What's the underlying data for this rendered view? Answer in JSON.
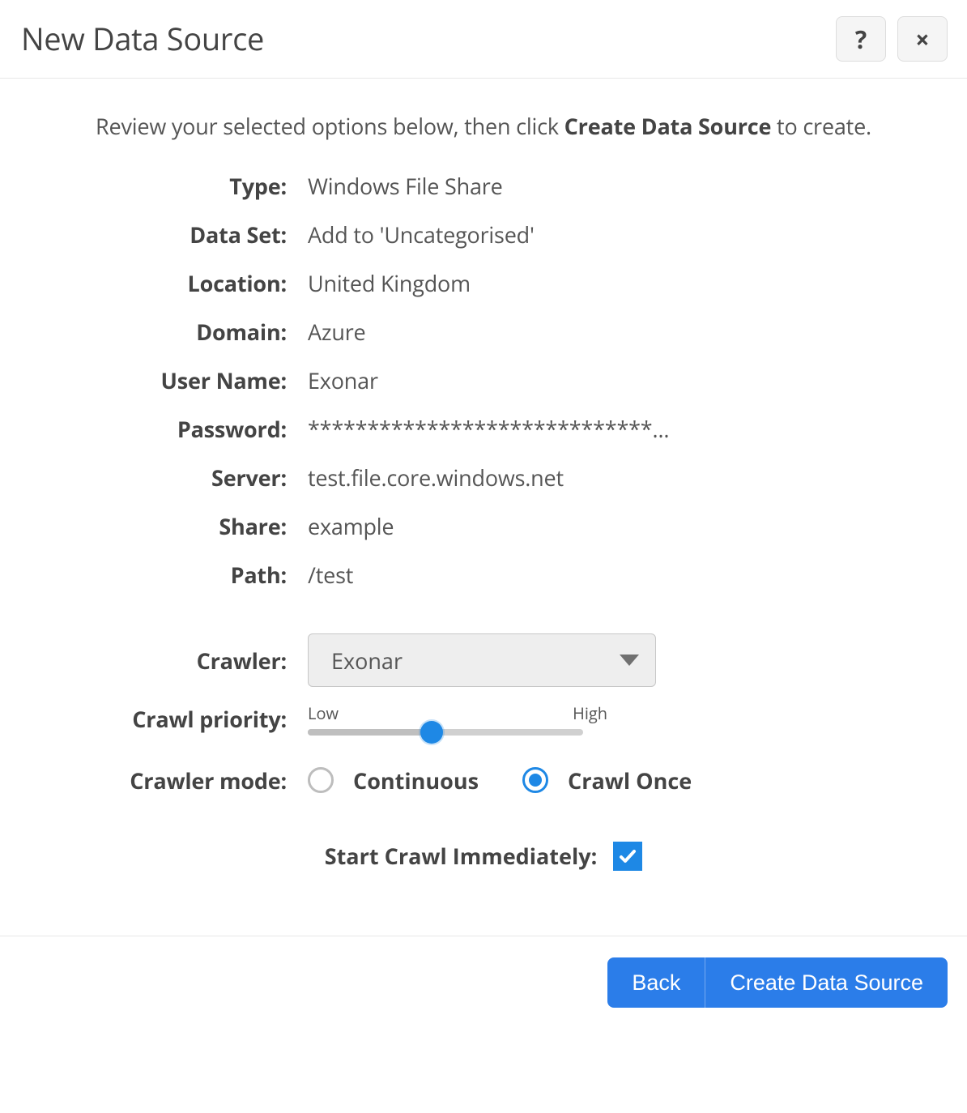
{
  "header": {
    "title": "New Data Source",
    "help_icon": "?",
    "close_icon": "×"
  },
  "intro": {
    "prefix": "Review your selected options below, then click ",
    "bold": "Create Data Source",
    "suffix": " to create."
  },
  "fields": {
    "type_label": "Type:",
    "type_value": "Windows File Share",
    "dataset_label": "Data Set:",
    "dataset_value": "Add to 'Uncategorised'",
    "location_label": "Location:",
    "location_value": "United Kingdom",
    "domain_label": "Domain:",
    "domain_value": "Azure",
    "username_label": "User Name:",
    "username_value": "Exonar",
    "password_label": "Password:",
    "password_value": "*****************************…",
    "server_label": "Server:",
    "server_value": "test.file.core.windows.net",
    "share_label": "Share:",
    "share_value": "example",
    "path_label": "Path:",
    "path_value": "/test"
  },
  "crawler": {
    "label": "Crawler:",
    "selected": "Exonar"
  },
  "priority": {
    "label": "Crawl priority:",
    "low": "Low",
    "high": "High",
    "value_percent": 45
  },
  "mode": {
    "label": "Crawler mode:",
    "continuous": "Continuous",
    "once": "Crawl Once",
    "selected": "once"
  },
  "start": {
    "label": "Start Crawl Immediately:",
    "checked": true
  },
  "footer": {
    "back": "Back",
    "create": "Create Data Source"
  }
}
